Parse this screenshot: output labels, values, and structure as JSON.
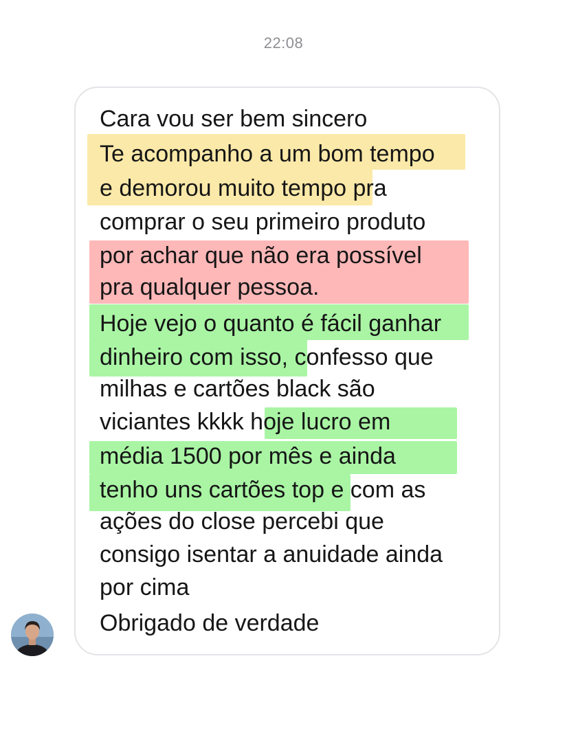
{
  "timestamp": "22:08",
  "message": {
    "lines": [
      "Cara vou ser bem sincero",
      "Te acompanho a um bom tempo",
      "e demorou muito tempo pra",
      "comprar o seu primeiro produto",
      "por achar que não era possível",
      "pra qualquer pessoa.",
      "Hoje vejo o quanto é fácil ganhar",
      "dinheiro com isso, confesso que",
      "milhas e cartões black são",
      "viciantes kkkk  hoje lucro em",
      "média 1500 por mês e ainda",
      "tenho uns cartões top e com as",
      "ações do close percebi que",
      "consigo isentar a anuidade ainda",
      "por cima",
      "Obrigado de verdade"
    ]
  },
  "highlight_colors": {
    "yellow": "#fbe9a9",
    "red": "#ffb8b8",
    "green": "#a9f5a4"
  },
  "avatar": {
    "icon": "person-avatar-icon"
  }
}
